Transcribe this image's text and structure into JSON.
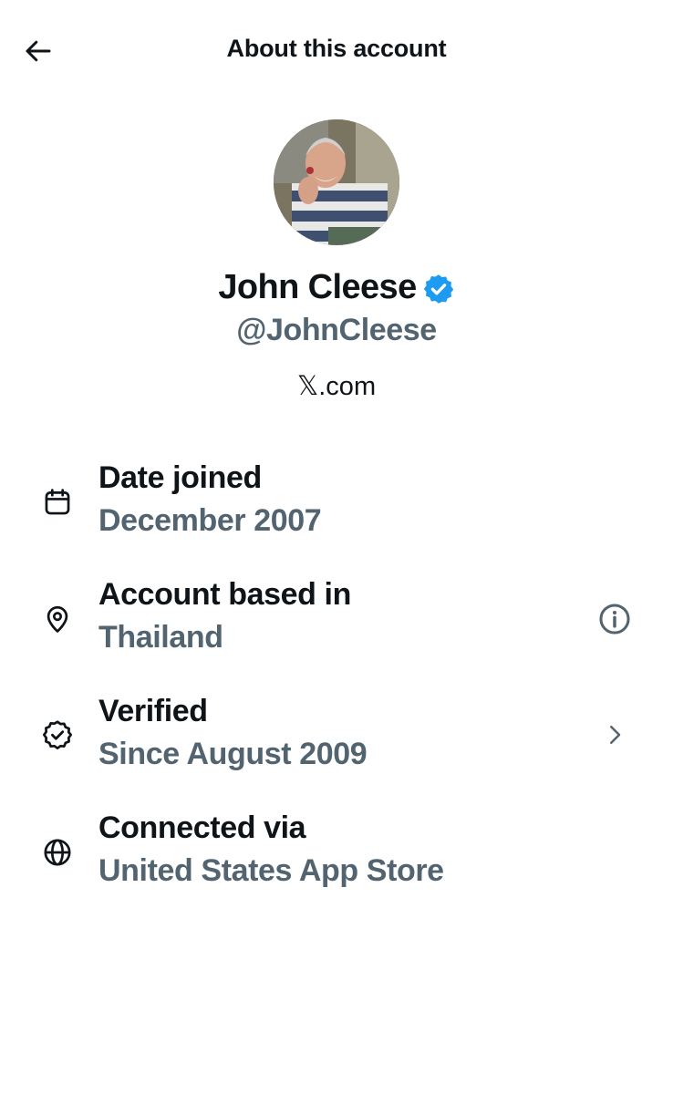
{
  "header": {
    "title": "About this account",
    "back_icon": "arrow-left-icon"
  },
  "profile": {
    "name": "John Cleese",
    "handle": "@JohnCleese",
    "site": "𝕏.com",
    "verified_badge_color": "#1d9bf0"
  },
  "info": [
    {
      "icon": "calendar-icon",
      "title": "Date joined",
      "value": "December 2007",
      "action": ""
    },
    {
      "icon": "location-pin-icon",
      "title": "Account based in",
      "value": "Thailand",
      "action": "info-icon"
    },
    {
      "icon": "verified-check-icon",
      "title": "Verified",
      "value": "Since August 2009",
      "action": "chevron-right-icon"
    },
    {
      "icon": "globe-icon",
      "title": "Connected via",
      "value": "United States App Store",
      "action": ""
    }
  ],
  "colors": {
    "text_primary": "#0f1419",
    "text_secondary": "#536471",
    "accent": "#1d9bf0",
    "background": "#ffffff"
  }
}
